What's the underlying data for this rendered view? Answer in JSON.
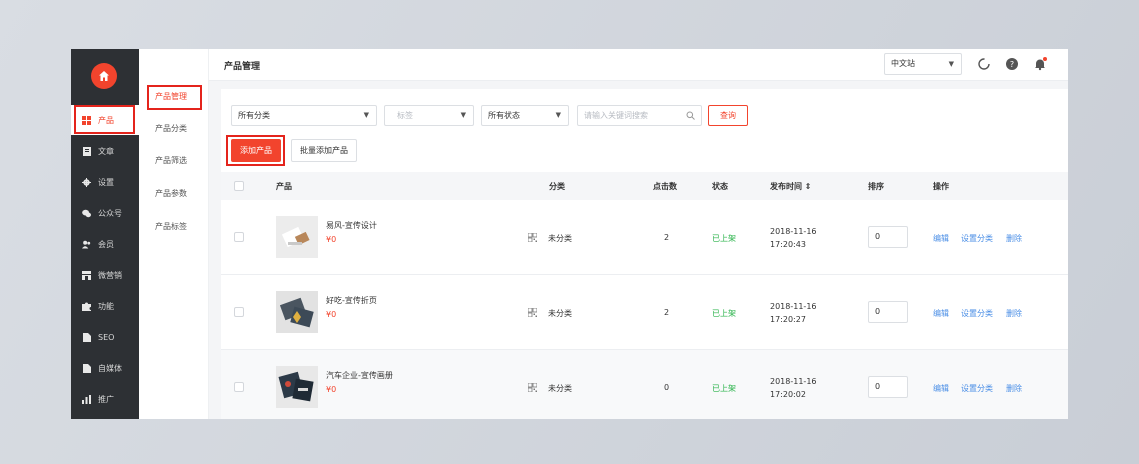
{
  "sidebar": {
    "items": [
      {
        "icon": "grid-icon",
        "label": "产品"
      },
      {
        "icon": "document-icon",
        "label": "文章"
      },
      {
        "icon": "gear-icon",
        "label": "设置"
      },
      {
        "icon": "wechat-icon",
        "label": "公众号"
      },
      {
        "icon": "member-icon",
        "label": "会员"
      },
      {
        "icon": "shop-icon",
        "label": "微营销"
      },
      {
        "icon": "puzzle-icon",
        "label": "功能"
      },
      {
        "icon": "seo-icon",
        "label": "SEO"
      },
      {
        "icon": "media-icon",
        "label": "自媒体"
      },
      {
        "icon": "chart-icon",
        "label": "推广"
      }
    ]
  },
  "submenu": {
    "items": [
      "产品管理",
      "产品分类",
      "产品筛选",
      "产品参数",
      "产品标签"
    ]
  },
  "header": {
    "title": "产品管理",
    "language": "中文站"
  },
  "filters": {
    "category": "所有分类",
    "tag_placeholder": "标签",
    "status": "所有状态",
    "search_placeholder": "请输入关键词搜索",
    "query_label": "查询"
  },
  "toolbar": {
    "add_label": "添加产品",
    "bulk_add_label": "批量添加产品"
  },
  "table": {
    "headers": {
      "product": "产品",
      "category": "分类",
      "clicks": "点击数",
      "status": "状态",
      "published": "发布时间 ⇕",
      "sort": "排序",
      "actions": "操作"
    },
    "rows": [
      {
        "name": "易风-宣传设计",
        "price": "¥0",
        "category": "未分类",
        "clicks": "2",
        "status": "已上架",
        "date": "2018-11-16",
        "time": "17:20:43",
        "sort": "0"
      },
      {
        "name": "好吃-宣传折页",
        "price": "¥0",
        "category": "未分类",
        "clicks": "2",
        "status": "已上架",
        "date": "2018-11-16",
        "time": "17:20:27",
        "sort": "0"
      },
      {
        "name": "汽车企业-宣传画册",
        "price": "¥0",
        "category": "未分类",
        "clicks": "0",
        "status": "已上架",
        "date": "2018-11-16",
        "time": "17:20:02",
        "sort": "0"
      }
    ],
    "actions": {
      "edit": "编辑",
      "set_category": "设置分类",
      "delete": "删除"
    }
  },
  "colors": {
    "accent": "#f2442d",
    "sidebar_bg": "#2d3034",
    "status_green": "#2ab34a",
    "link_blue": "#4a8ee6",
    "highlight": "#e4241c"
  }
}
